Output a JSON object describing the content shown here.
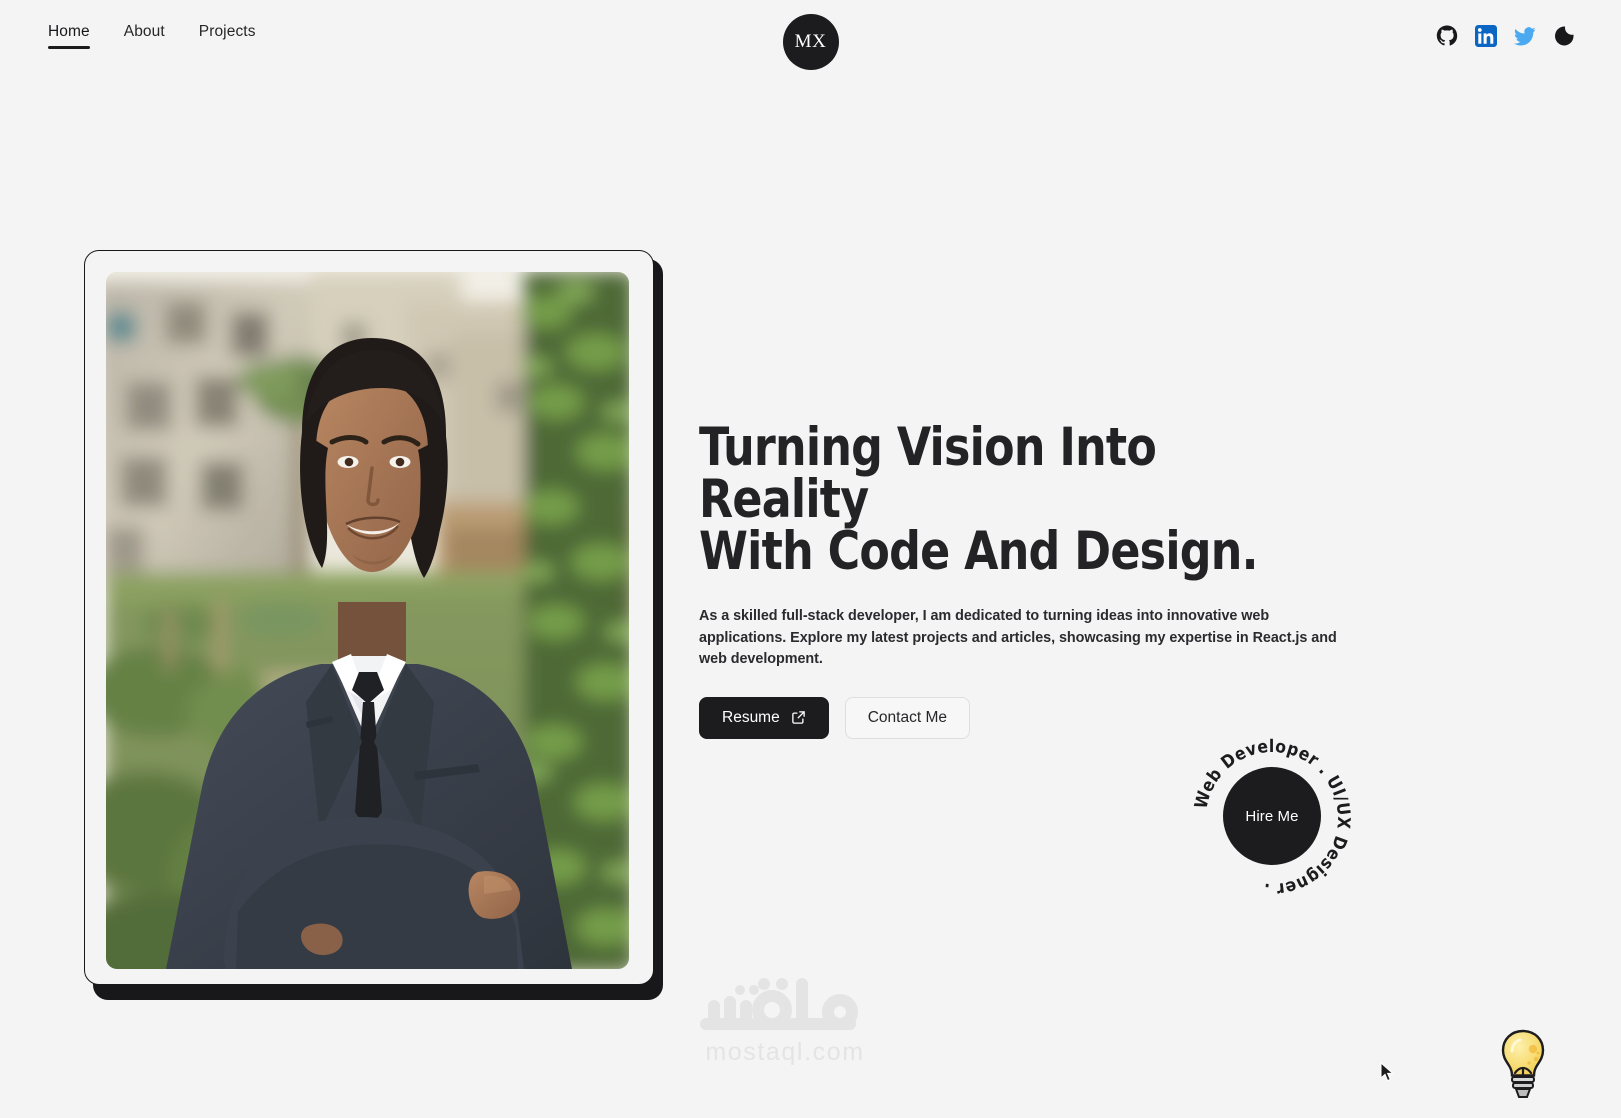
{
  "page": {
    "background_color": "#f4f4f4",
    "text_color": "#232326",
    "accent_dark": "#1c1c1e"
  },
  "header": {
    "nav": [
      {
        "label": "Home",
        "active": true
      },
      {
        "label": "About",
        "active": false
      },
      {
        "label": "Projects",
        "active": false
      }
    ],
    "logo": {
      "initials": "MX",
      "bg_color": "#1c1c1e",
      "text_color": "#ffffff"
    },
    "socials": [
      {
        "name": "github-icon",
        "label": "GitHub",
        "color": "#18181b"
      },
      {
        "name": "linkedin-icon",
        "label": "LinkedIn",
        "color": "#0a66c2"
      },
      {
        "name": "twitter-icon",
        "label": "Twitter",
        "color": "#4aa9f0"
      },
      {
        "name": "dark-mode-icon",
        "label": "Dark mode",
        "color": "#18181b"
      }
    ]
  },
  "hero": {
    "headline_line1": "Turning Vision Into Reality",
    "headline_line2": "With Code And Design.",
    "paragraph": "As a skilled full-stack developer, I am dedicated to turning ideas into innovative web applications. Explore my latest projects and articles, showcasing my expertise in React.js and web development.",
    "buttons": {
      "primary_label": "Resume",
      "primary_icon": "external-link-icon",
      "secondary_label": "Contact Me"
    },
    "portrait": {
      "alt": "Portrait photo of developer in dark suit and black tie, arms crossed, blurred garden and apartment buildings background",
      "frame_border_color": "#18181b",
      "frame_shadow_color": "#18181b"
    }
  },
  "badge": {
    "center_label": "Hire Me",
    "ring_text": "Web Developer . UI/UX Designer .",
    "bg_color": "#1c1c1e",
    "text_color": "#ffffff"
  },
  "watermark": {
    "arabic": "مستقل",
    "url": "mostaql.com",
    "color": "#e4e4e4"
  },
  "widgets": {
    "lightbulb": {
      "name": "lightbulb-icon",
      "color": "#f5d769"
    }
  }
}
